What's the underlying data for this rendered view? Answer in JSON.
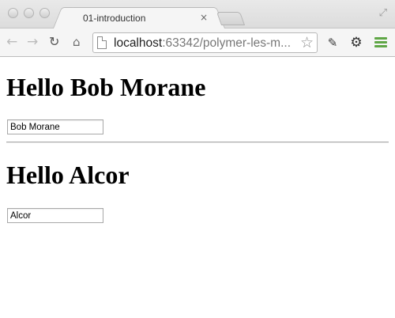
{
  "browser": {
    "tab": {
      "title": "01-introduction",
      "close_glyph": "×"
    },
    "toolbar": {
      "url_host": "localhost",
      "url_rest": ":63342/polymer-les-m...",
      "icons": {
        "back": "back-arrow-icon",
        "forward": "forward-arrow-icon",
        "reload": "reload-icon",
        "home": "home-icon",
        "page": "page-icon",
        "star": "bookmark-star-icon",
        "evernote": "evernote-icon",
        "settings": "gear-icon",
        "menu": "hamburger-menu-icon"
      },
      "menu_color": "#5fa646"
    }
  },
  "page": {
    "sections": [
      {
        "heading": "Hello Bob Morane",
        "input_value": "Bob Morane"
      },
      {
        "heading": "Hello Alcor",
        "input_value": "Alcor"
      }
    ]
  }
}
